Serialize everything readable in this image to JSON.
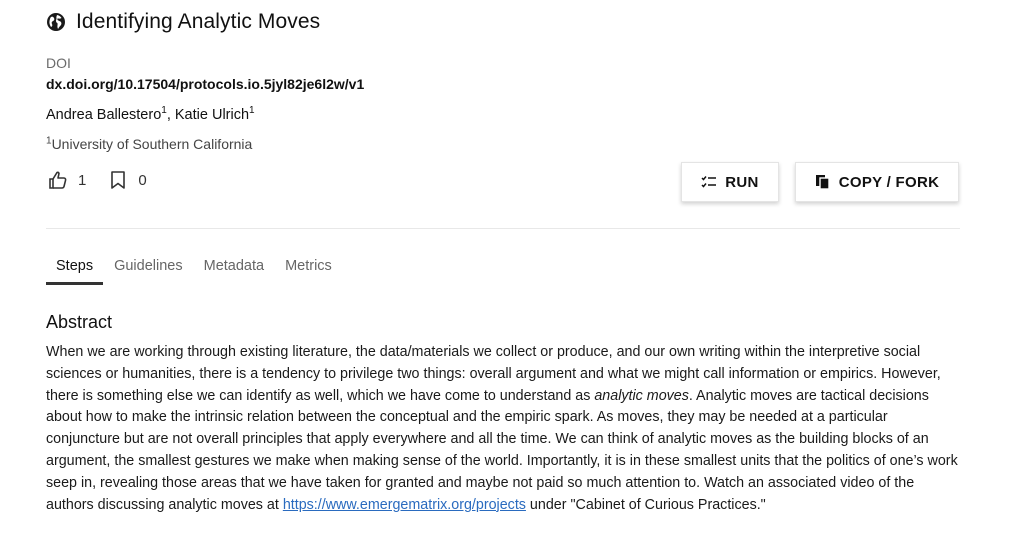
{
  "protocol": {
    "title": "Identifying Analytic Moves",
    "doi_label": "DOI",
    "doi": "dx.doi.org/10.17504/protocols.io.5jyl82je6l2w/v1",
    "authors": [
      {
        "name": "Andrea Ballestero",
        "sup": "1",
        "sep": ", "
      },
      {
        "name": "Katie Ulrich",
        "sup": "1",
        "sep": ""
      }
    ],
    "affiliation": {
      "sup": "1",
      "name": "University of Southern California"
    }
  },
  "stats": {
    "likes": "1",
    "bookmarks": "0"
  },
  "actions": {
    "run_label": "RUN",
    "fork_label": "COPY / FORK"
  },
  "tabs": [
    {
      "label": "Steps",
      "active": true
    },
    {
      "label": "Guidelines",
      "active": false
    },
    {
      "label": "Metadata",
      "active": false
    },
    {
      "label": "Metrics",
      "active": false
    }
  ],
  "abstract": {
    "heading": "Abstract",
    "text_1": "When we are working through existing literature, the data/materials we collect or produce, and our own writing within the interpretive social sciences or humanities, there is a tendency to privilege two things: overall argument and what we might call information or empirics. However, there is something else we can identify as well, which we have come to understand as ",
    "emphasis": "analytic moves",
    "text_2": ". Analytic moves are tactical decisions about how to make the intrinsic relation between the conceptual and the empiric spark. As moves, they may be needed at a particular conjuncture but are not overall principles that apply everywhere and all the time. We can think of analytic moves as the building blocks of an argument, the smallest gestures we make when making sense of the world. Importantly, it is in these smallest units that the politics of one’s work seep in, revealing those areas that we have taken for granted and maybe not paid so much attention to. Watch an associated video of the authors discussing analytic moves at ",
    "link": "https://www.emergematrix.org/projects",
    "text_3": " under \"Cabinet of Curious Practices.\""
  },
  "colors": {
    "link": "#2a6bbf",
    "text": "#1a1a1a",
    "muted": "#6b6b6b"
  }
}
